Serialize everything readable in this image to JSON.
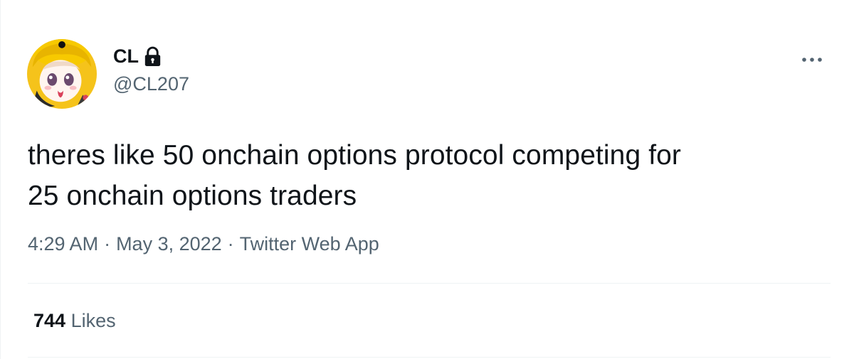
{
  "author": {
    "display_name": "CL",
    "handle": "@CL207",
    "avatar_icon": "anime-character-avatar",
    "protected_icon": "lock-icon"
  },
  "tweet": {
    "text_line1": "theres like 50 onchain options protocol competing for",
    "text_line2": "25 onchain options traders"
  },
  "meta": {
    "time": "4:29 AM",
    "separator": "·",
    "date": "May 3, 2022",
    "source": "Twitter Web App"
  },
  "stats": {
    "likes_count": "744",
    "likes_label": "Likes"
  },
  "colors": {
    "text": "#0f1419",
    "secondary": "#536471",
    "divider": "#eff3f4",
    "avatar_bg": "#f5c31b"
  }
}
